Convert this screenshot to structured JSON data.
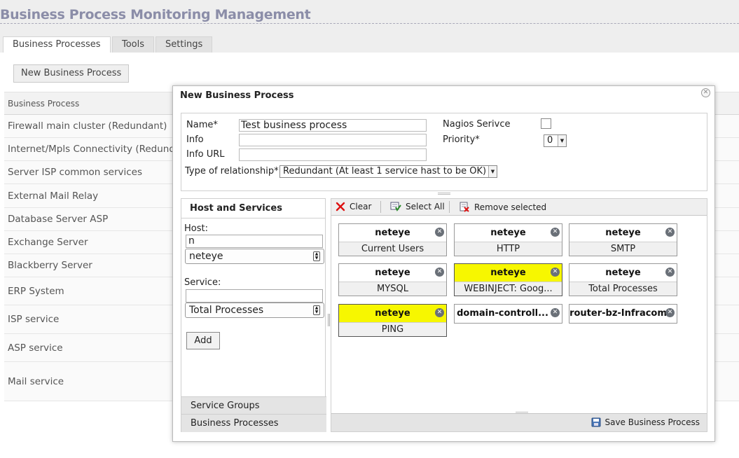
{
  "page": {
    "title": "Business Process Monitoring Management",
    "tabs": [
      "Business Processes",
      "Tools",
      "Settings"
    ]
  },
  "toolbar": {
    "new_bp_label": "New Business Process"
  },
  "list": {
    "header": "Business Process",
    "rows": [
      "Firewall main cluster (Redundant)",
      "Internet/Mpls Connectivity (Redundan",
      "Server ISP common services",
      "External Mail Relay",
      "Database Server ASP",
      "Exchange Server",
      "Blackberry Server",
      "ERP System",
      "ISP service",
      "ASP service",
      "Mail service"
    ]
  },
  "dialog": {
    "title": "New Business Process",
    "name_label": "Name*",
    "name_value": "Test business process",
    "info_label": "Info",
    "info_value": "",
    "info_url_label": "Info URL",
    "info_url_value": "",
    "nagios_label": "Nagios Serivce",
    "priority_label": "Priority*",
    "priority_value": "0",
    "relationship_label": "Type of relationship*",
    "relationship_value": "Redundant (At least 1 service hast to be OK)",
    "left_panel": {
      "title": "Host and Services",
      "host_label": "Host:",
      "host_filter": "n",
      "host_selected": "neteye",
      "service_label": "Service:",
      "service_filter": "",
      "service_selected": "Total Processes",
      "add_label": "Add",
      "service_groups_label": "Service Groups",
      "business_processes_label": "Business Processes"
    },
    "right_panel": {
      "clear_label": "Clear",
      "select_all_label": "Select All",
      "remove_selected_label": "Remove selected",
      "save_label": "Save Business Process",
      "cards": [
        {
          "host": "neteye",
          "service": "Current Users",
          "warn": false
        },
        {
          "host": "neteye",
          "service": "HTTP",
          "warn": false
        },
        {
          "host": "neteye",
          "service": "SMTP",
          "warn": false
        },
        {
          "host": "neteye",
          "service": "MYSQL",
          "warn": false
        },
        {
          "host": "neteye",
          "service": "WEBINJECT: Goog...",
          "warn": true
        },
        {
          "host": "neteye",
          "service": "Total Processes",
          "warn": false
        },
        {
          "host": "neteye",
          "service": "PING",
          "warn": true
        },
        {
          "host": "domain-controll...",
          "service": "",
          "warn": false
        },
        {
          "host": "router-bz-Infracom",
          "service": "",
          "warn": false
        }
      ]
    },
    "colors": {
      "warning": "#f7f700",
      "title": "#8b8da8"
    }
  }
}
